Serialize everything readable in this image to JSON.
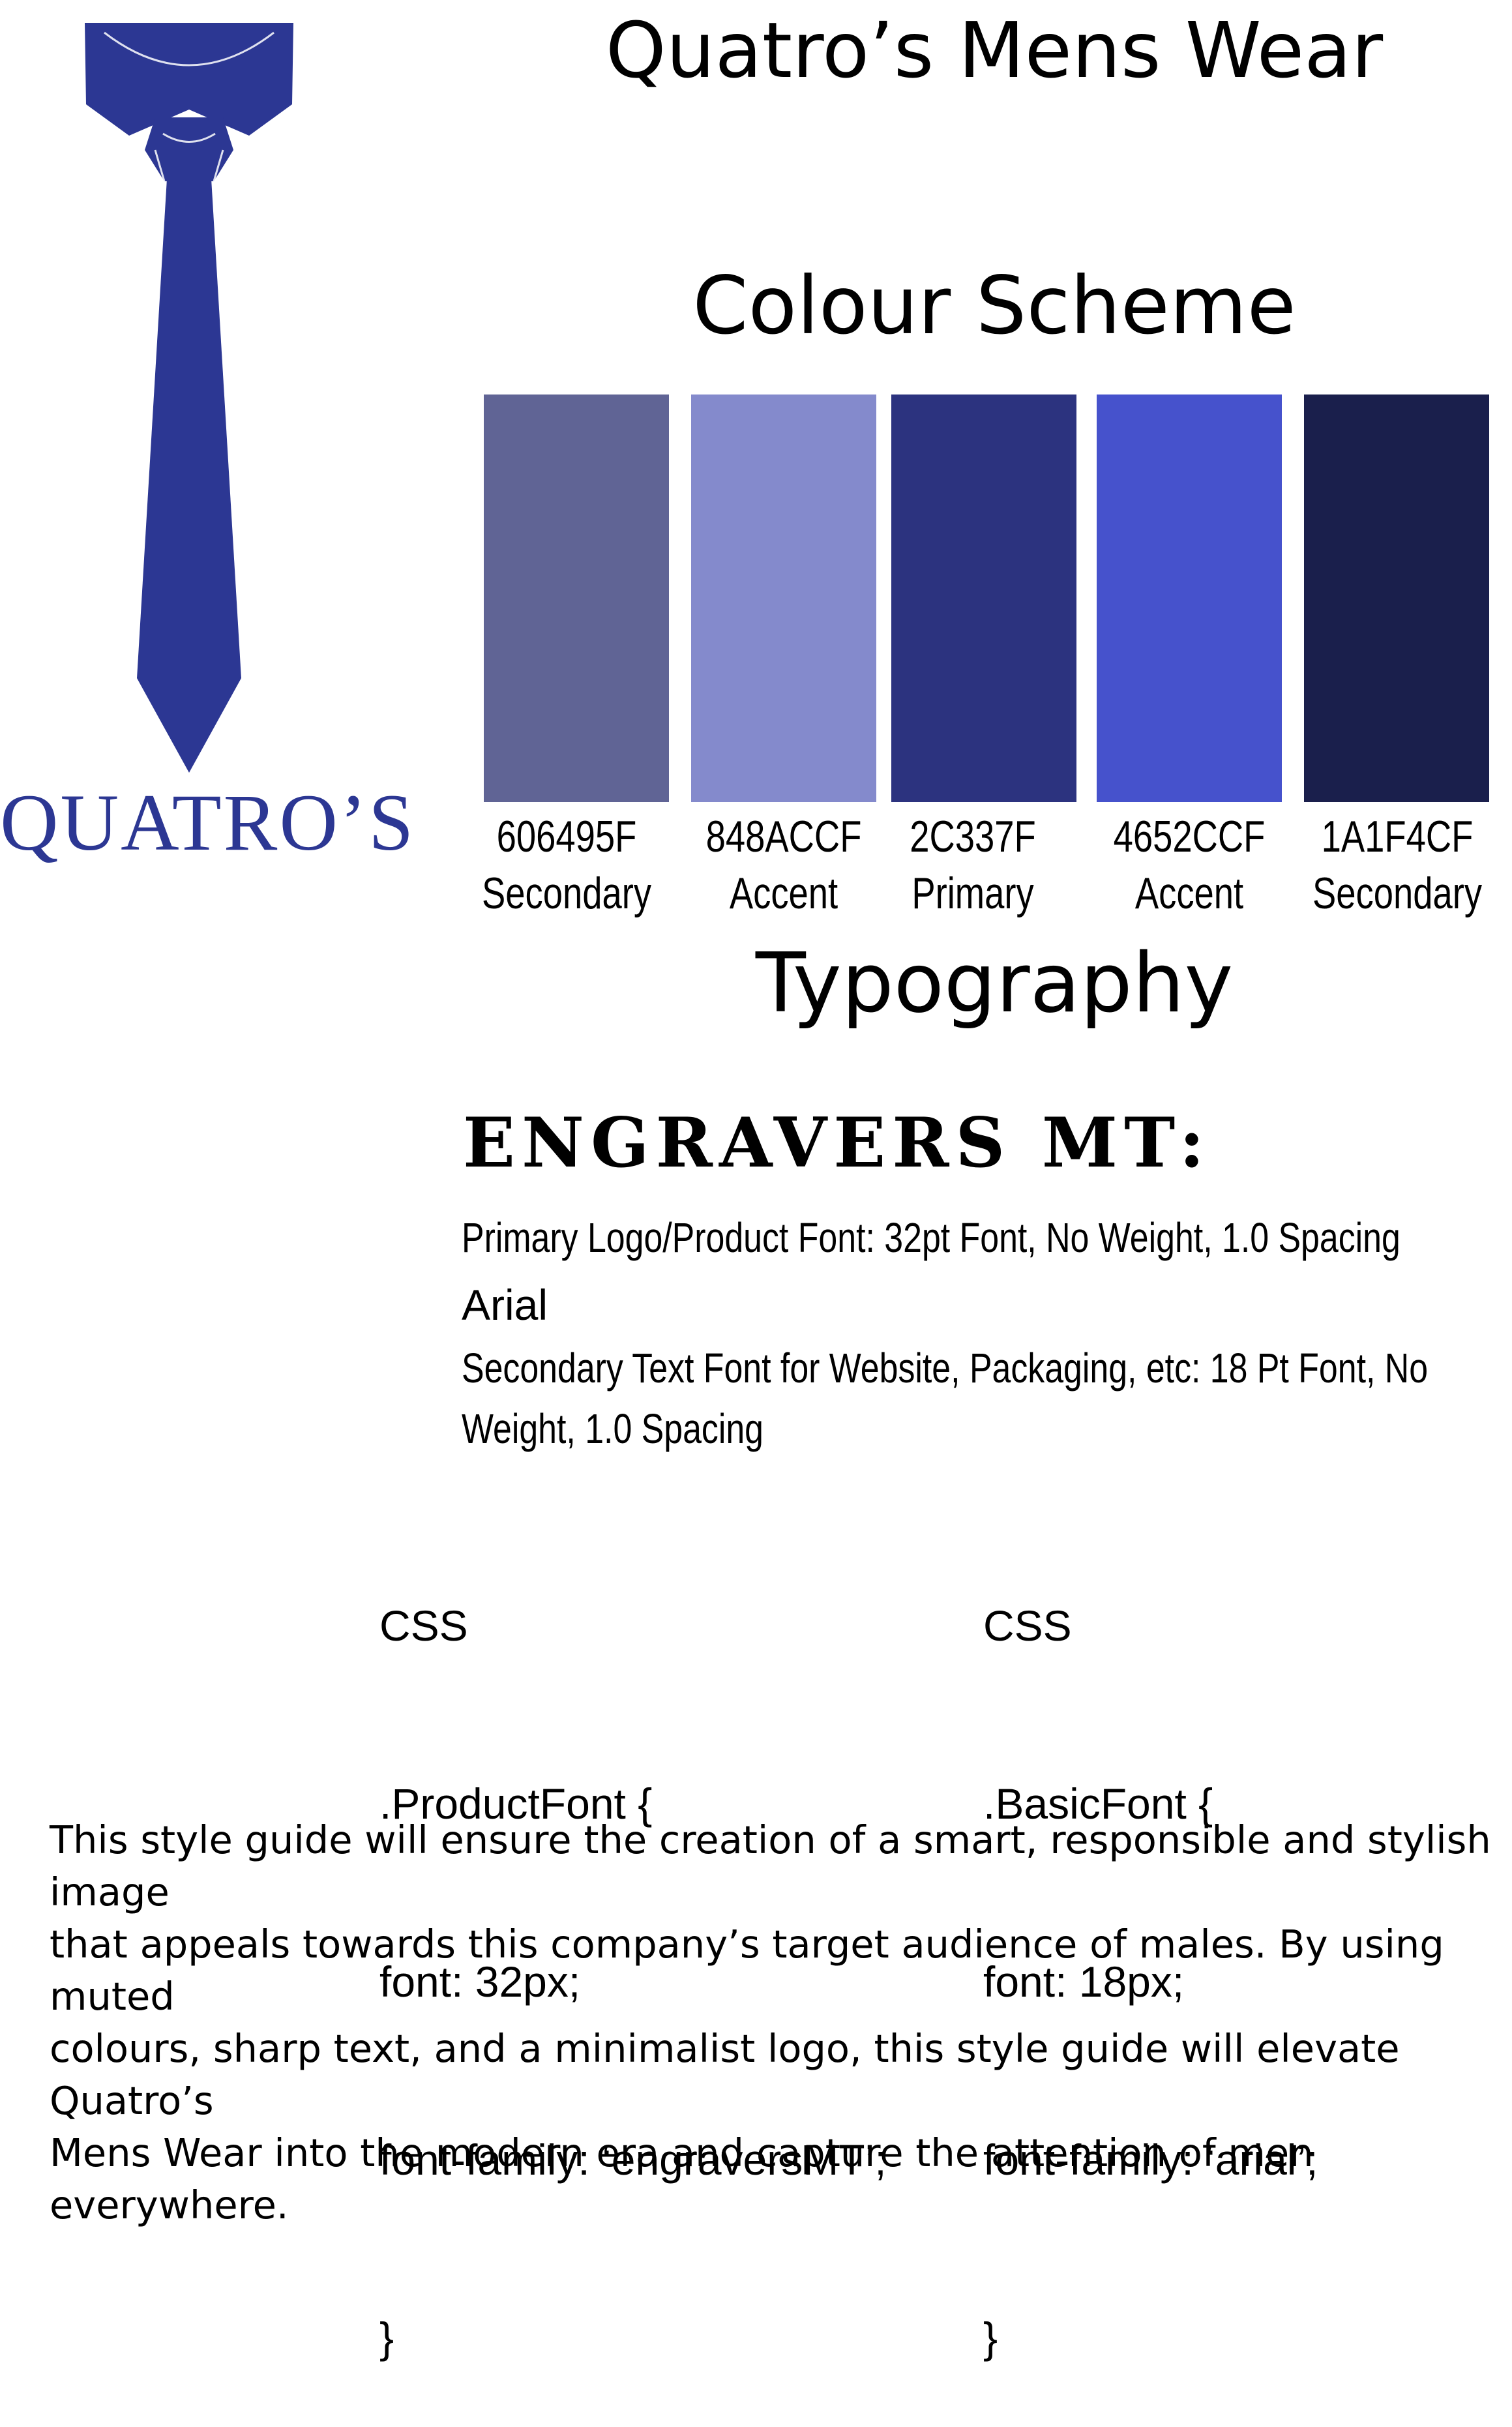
{
  "brand": {
    "title": "Quatro’s Mens Wear",
    "wordmark": "QUATRO’S",
    "logo_color": "#2c3793"
  },
  "colour_scheme": {
    "heading": "Colour Scheme",
    "swatches": [
      {
        "code": "606495F",
        "role": "Secondary",
        "color": "#606495"
      },
      {
        "code": "848ACCF",
        "role": "Accent",
        "color": "#848acc"
      },
      {
        "code": "2C337F",
        "role": "Primary",
        "color": "#2c337f"
      },
      {
        "code": "4652CCF",
        "role": "Accent",
        "color": "#4652cc"
      },
      {
        "code": "1A1F4CF",
        "role": "Secondary",
        "color": "#1a1f4c"
      }
    ]
  },
  "typography": {
    "heading": "Typography",
    "primary_font_title": "ENGRAVERS MT:",
    "primary_font_desc": "Primary Logo/Product Font:  32pt Font, No Weight, 1.0 Spacing",
    "secondary_font_title": "Arial",
    "secondary_font_desc_line1": "Secondary Text Font for Website, Packaging, etc: 18 Pt Font, No",
    "secondary_font_desc_line2": "Weight, 1.0 Spacing"
  },
  "css_examples": [
    {
      "label": "CSS",
      "selector": ".ProductFont {",
      "font_line": "font: 32px;",
      "family_line": "font-family: ‘engraversMT’;",
      "close": "}"
    },
    {
      "label": "CSS",
      "selector": ".BasicFont {",
      "font_line": "font: 18px;",
      "family_line": "font-family: ‘arial’;",
      "close": "}"
    }
  ],
  "summary": {
    "line1": "This style guide will ensure the creation of a smart, responsible and stylish image",
    "line2": "that appeals towards this company’s target audience of males. By using muted",
    "line3": "colours, sharp text, and a minimalist logo, this style guide will elevate Quatro’s",
    "line4": "Mens Wear into the modern era and capture the attention of men everywhere."
  }
}
